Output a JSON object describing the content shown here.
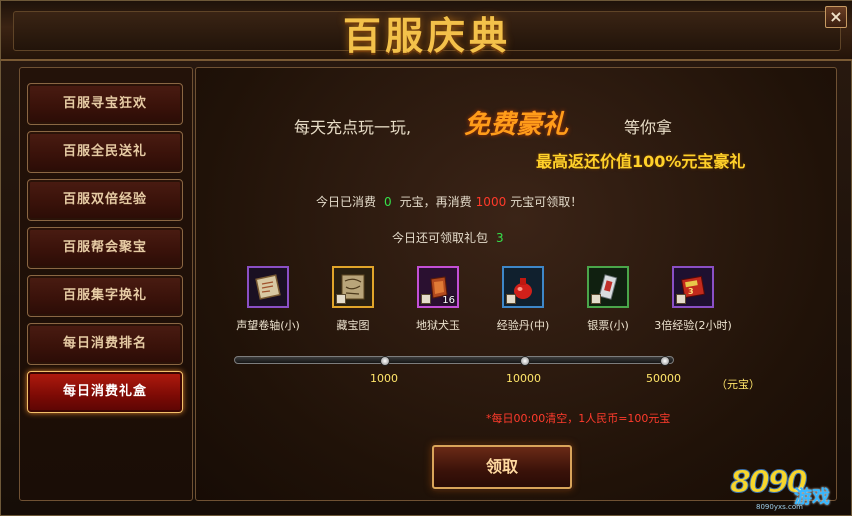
{
  "window": {
    "title": "百服庆典",
    "close_label": "×"
  },
  "sidebar": {
    "items": [
      {
        "label": "百服寻宝狂欢",
        "active": false
      },
      {
        "label": "百服全民送礼",
        "active": false
      },
      {
        "label": "百服双倍经验",
        "active": false
      },
      {
        "label": "百服帮会聚宝",
        "active": false
      },
      {
        "label": "百服集字换礼",
        "active": false
      },
      {
        "label": "每日消费排名",
        "active": false
      },
      {
        "label": "每日消费礼盒",
        "active": true
      }
    ]
  },
  "main": {
    "slogan_part1": "每天充点玩一玩,",
    "slogan_highlight": "免费豪礼",
    "slogan_part2": "等你拿",
    "headline": "最高返还价值100%元宝豪礼",
    "consume": {
      "prefix": "今日已消费",
      "spent": "0",
      "mid": "元宝，再消费",
      "needed": "1000",
      "suffix": "元宝可领取！"
    },
    "gift": {
      "label": "今日还可领取礼包",
      "count": "3"
    },
    "items": [
      {
        "name": "声望卷轴(小)",
        "icon": "scroll-icon",
        "border": "#8a4fc5",
        "locked": false,
        "count": ""
      },
      {
        "name": "藏宝图",
        "icon": "treasure-map-icon",
        "border": "#e1a52a",
        "locked": true,
        "count": ""
      },
      {
        "name": "地狱犬玉",
        "icon": "hellhound-jade-icon",
        "border": "#c34fd6",
        "locked": true,
        "count": "16"
      },
      {
        "name": "经验丹(中)",
        "icon": "exp-pill-icon",
        "border": "#3e87c8",
        "locked": true,
        "count": ""
      },
      {
        "name": "银票(小)",
        "icon": "silver-note-icon",
        "border": "#4aa64a",
        "locked": true,
        "count": ""
      },
      {
        "name": "3倍经验(2小时)",
        "icon": "exp-book-icon",
        "border": "#8a4fc5",
        "locked": true,
        "count": ""
      }
    ],
    "progress": {
      "value_fraction": 0.0,
      "ticks": [
        "1000",
        "10000",
        "50000"
      ],
      "unit": "（元宝）"
    },
    "reset_note": "*每日00:00清空，1人民币=100元宝",
    "claim_label": "领取"
  },
  "logo": {
    "text_digits": "8090",
    "text_word": "游戏",
    "subtext": "8090yxs.com"
  },
  "colors": {
    "accent_gold": "#f3c14a",
    "active_red": "#b21b0e",
    "green_value": "#36e04a",
    "red_value": "#ff3a2a"
  }
}
